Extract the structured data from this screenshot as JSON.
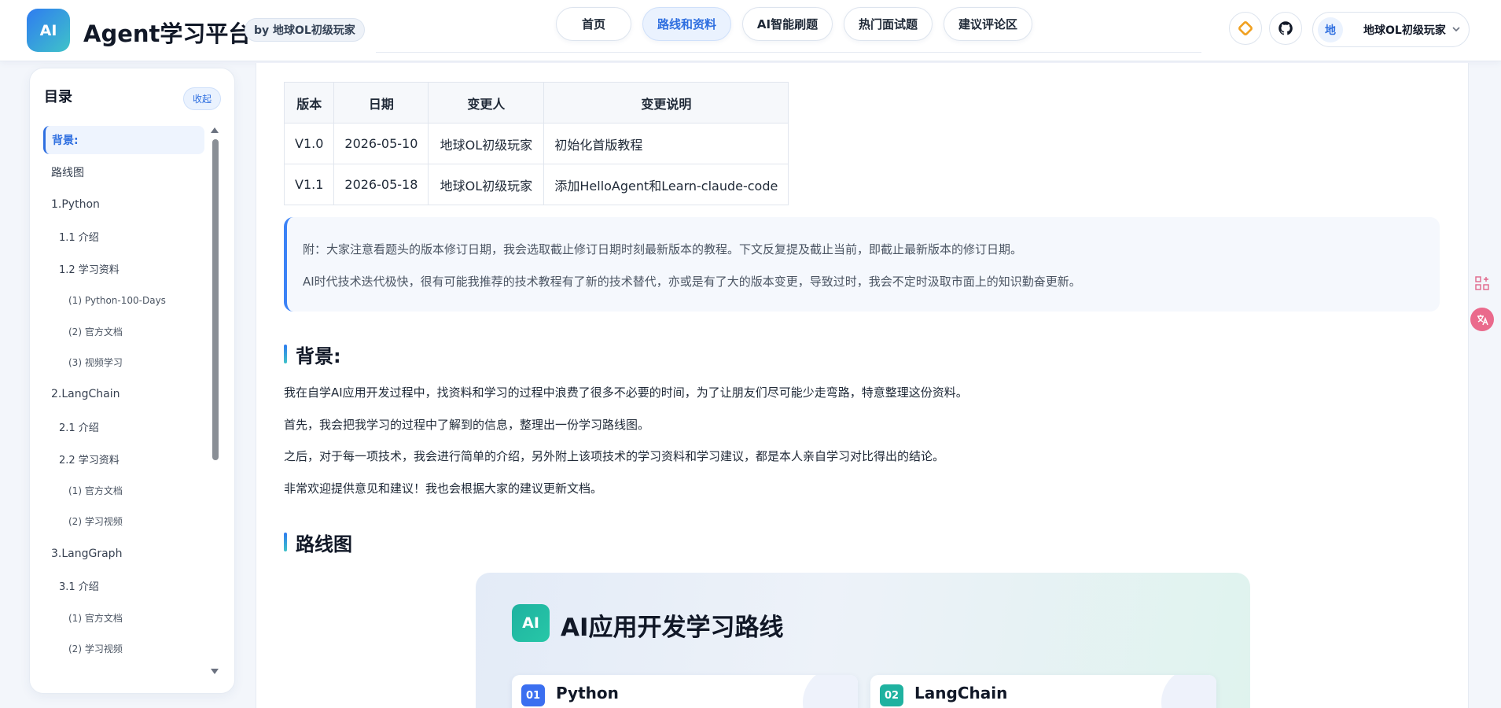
{
  "header": {
    "logo": "AI",
    "title": "Agent学习平台",
    "author_chip": "by 地球OL初级玩家",
    "nav": [
      "首页",
      "路线和资料",
      "AI智能刷题",
      "热门面试题",
      "建议评论区"
    ],
    "active_nav": "路线和资料",
    "user": {
      "avatar": "地",
      "name": "地球OL初级玩家"
    },
    "icons": [
      "diamond-icon",
      "github-icon",
      "chevron-down-icon"
    ]
  },
  "sidebar": {
    "title": "目录",
    "collapse_label": "收起",
    "items": [
      {
        "label": "背景:",
        "level": 1,
        "active": true
      },
      {
        "label": "路线图",
        "level": 1
      },
      {
        "label": "1.Python",
        "level": 1
      },
      {
        "label": "1.1 介绍",
        "level": 2
      },
      {
        "label": "1.2 学习资料",
        "level": 2
      },
      {
        "label": "(1) Python-100-Days",
        "level": 3
      },
      {
        "label": "(2) 官方文档",
        "level": 3
      },
      {
        "label": "(3) 视频学习",
        "level": 3
      },
      {
        "label": "2.LangChain",
        "level": 1
      },
      {
        "label": "2.1 介绍",
        "level": 2
      },
      {
        "label": "2.2 学习资料",
        "level": 2
      },
      {
        "label": "(1) 官方文档",
        "level": 3
      },
      {
        "label": "(2) 学习视频",
        "level": 3
      },
      {
        "label": "3.LangGraph",
        "level": 1
      },
      {
        "label": "3.1 介绍",
        "level": 2
      },
      {
        "label": "(1) 官方文档",
        "level": 3
      },
      {
        "label": "(2) 学习视频",
        "level": 3
      }
    ]
  },
  "main": {
    "table": {
      "headers": [
        "版本",
        "日期",
        "变更人",
        "变更说明"
      ],
      "rows": [
        [
          "V1.0",
          "2026-05-10",
          "地球OL初级玩家",
          "初始化首版教程"
        ],
        [
          "V1.1",
          "2026-05-18",
          "地球OL初级玩家",
          "添加HelloAgent和Learn-claude-code"
        ]
      ]
    },
    "note": [
      "附：大家注意看题头的版本修订日期，我会选取截止修订日期时刻最新版本的教程。下文反复提及截止当前，即截止最新版本的修订日期。",
      "AI时代技术迭代极快，很有可能我推荐的技术教程有了新的技术替代，亦或是有了大的版本变更，导致过时，我会不定时汲取市面上的知识勤奋更新。"
    ],
    "background": {
      "heading": "背景:",
      "paragraphs": [
        "我在自学AI应用开发过程中，找资料和学习的过程中浪费了很多不必要的时间，为了让朋友们尽可能少走弯路，特意整理这份资料。",
        "首先，我会把我学习的过程中了解到的信息，整理出一份学习路线图。",
        "之后，对于每一项技术，我会进行简单的介绍，另外附上该项技术的学习资料和学习建议，都是本人亲自学习对比得出的结论。",
        "非常欢迎提供意见和建议！我也会根据大家的建议更新文档。"
      ]
    },
    "roadmap": {
      "heading": "路线图",
      "badge": "AI",
      "title": "AI应用开发学习路线",
      "steps": [
        {
          "num": "01",
          "name": "Python",
          "color": "#3b6ff0"
        },
        {
          "num": "02",
          "name": "LangChain",
          "color": "#1fb2a0"
        }
      ]
    }
  },
  "colors": {
    "accent": "#2f6fe0",
    "teal": "#27c7a7",
    "note_border": "#3b82f6"
  },
  "floating_icons": [
    "apps-icon",
    "translate-icon"
  ]
}
